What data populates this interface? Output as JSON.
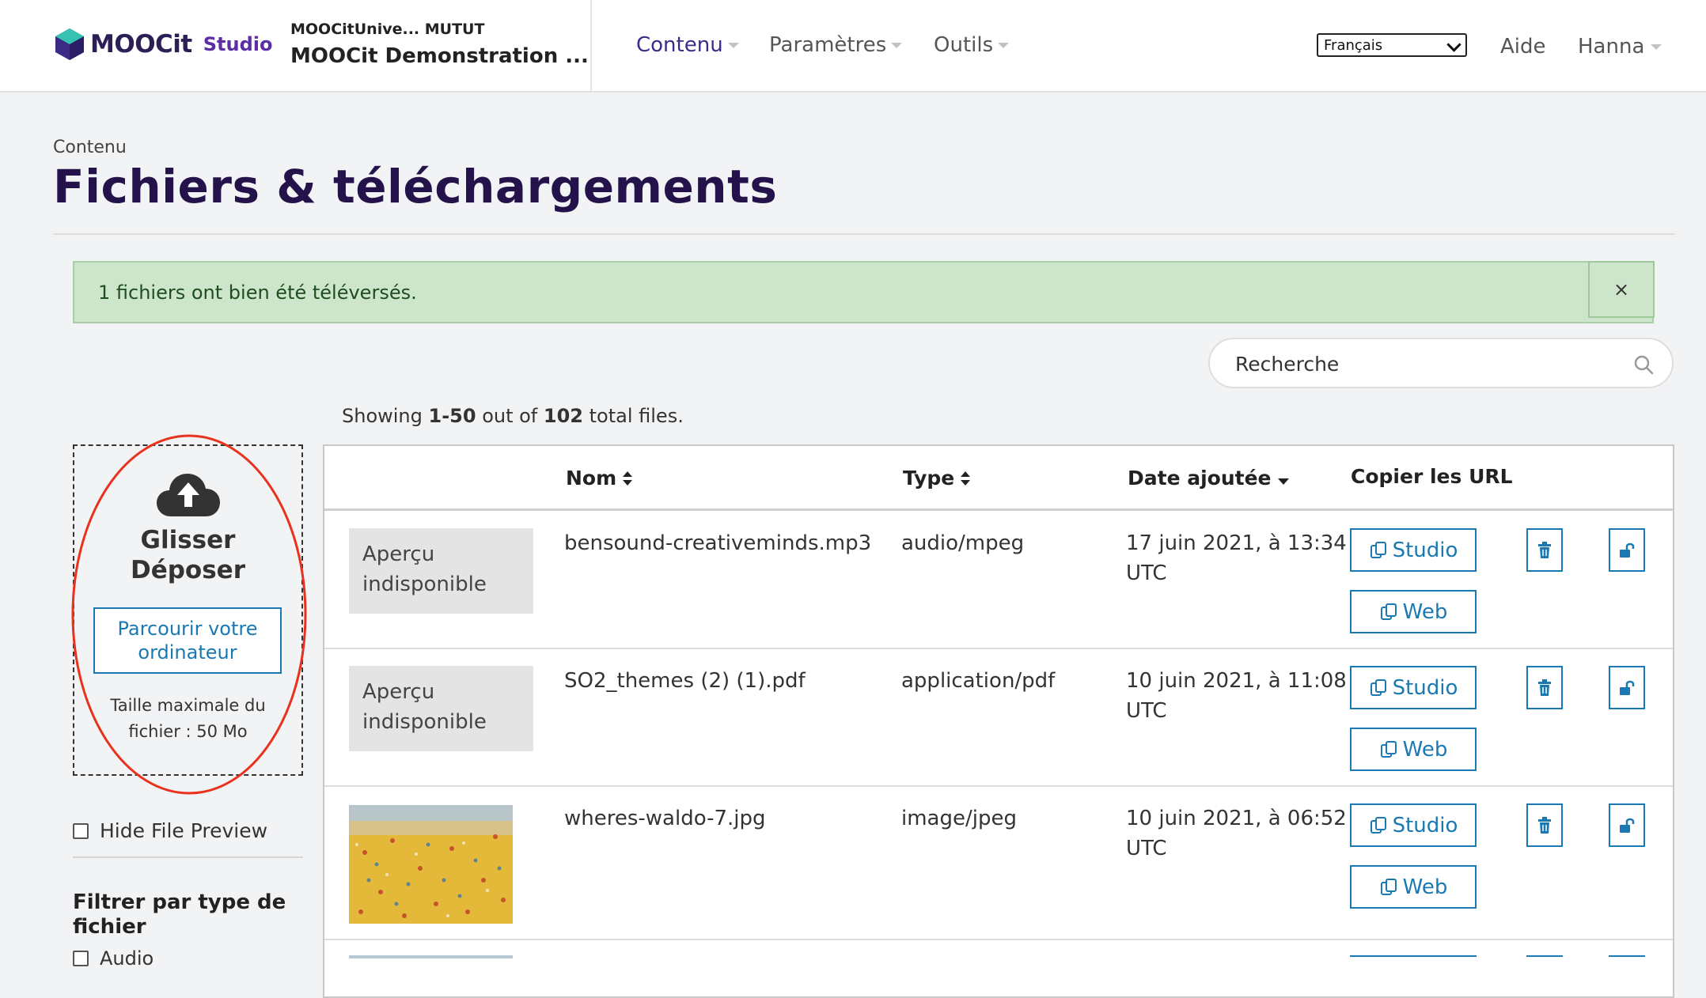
{
  "header": {
    "logo_text": "MOOCit",
    "logo_studio": "Studio",
    "course_org": "MOOCitUnive...  MUTUT",
    "course_name": "MOOCit Demonstration ...",
    "nav": [
      {
        "label": "Contenu",
        "active": true
      },
      {
        "label": "Paramètres",
        "active": false
      },
      {
        "label": "Outils",
        "active": false
      }
    ],
    "language": "Français",
    "help": "Aide",
    "user": "Hanna"
  },
  "page": {
    "breadcrumb": "Contenu",
    "title": "Fichiers & téléchargements"
  },
  "alert": {
    "message": "1 fichiers ont bien été téléversés.",
    "close": "×"
  },
  "search": {
    "placeholder": "Recherche"
  },
  "summary": {
    "prefix": "Showing ",
    "range": "1-50",
    "middle": " out of ",
    "total": "102",
    "suffix": " total files."
  },
  "dropzone": {
    "title_line1": "Glisser",
    "title_line2": "Déposer",
    "browse_line1": "Parcourir votre",
    "browse_line2": "ordinateur",
    "size_line1": "Taille maximale du",
    "size_line2": "fichier : 50 Mo"
  },
  "sidebar": {
    "hide_preview": "Hide File Preview",
    "filter_title_line1": "Filtrer par type de",
    "filter_title_line2": "fichier",
    "filter_first": "Audio"
  },
  "table": {
    "columns": {
      "name": "Nom",
      "type": "Type",
      "date": "Date ajoutée",
      "copy": "Copier les URL"
    },
    "rows": [
      {
        "preview_line1": "Aperçu",
        "preview_line2": "indisponible",
        "name": "bensound-creativeminds.mp3",
        "type": "audio/mpeg",
        "date_line1": "17 juin 2021, à 13:34",
        "date_line2": "UTC",
        "studio": "Studio",
        "web": "Web"
      },
      {
        "preview_line1": "Aperçu",
        "preview_line2": "indisponible",
        "name": "SO2_themes (2) (1).pdf",
        "type": "application/pdf",
        "date_line1": "10 juin 2021, à 11:08",
        "date_line2": "UTC",
        "studio": "Studio",
        "web": "Web"
      },
      {
        "preview_line1": "",
        "preview_line2": "",
        "name": "wheres-waldo-7.jpg",
        "type": "image/jpeg",
        "date_line1": "10 juin 2021, à 06:52",
        "date_line2": "UTC",
        "studio": "Studio",
        "web": "Web"
      }
    ]
  },
  "colors": {
    "brand": "#3c2b8a",
    "title": "#24134a",
    "link": "#1a79b3",
    "alert_bg": "#cde5cb",
    "annotation": "#e8321e"
  },
  "icons": [
    "logo-cube-icon",
    "caret-down-icon",
    "search-icon",
    "cloud-upload-icon",
    "copy-icon",
    "trash-icon",
    "unlock-icon",
    "sort-icon"
  ]
}
